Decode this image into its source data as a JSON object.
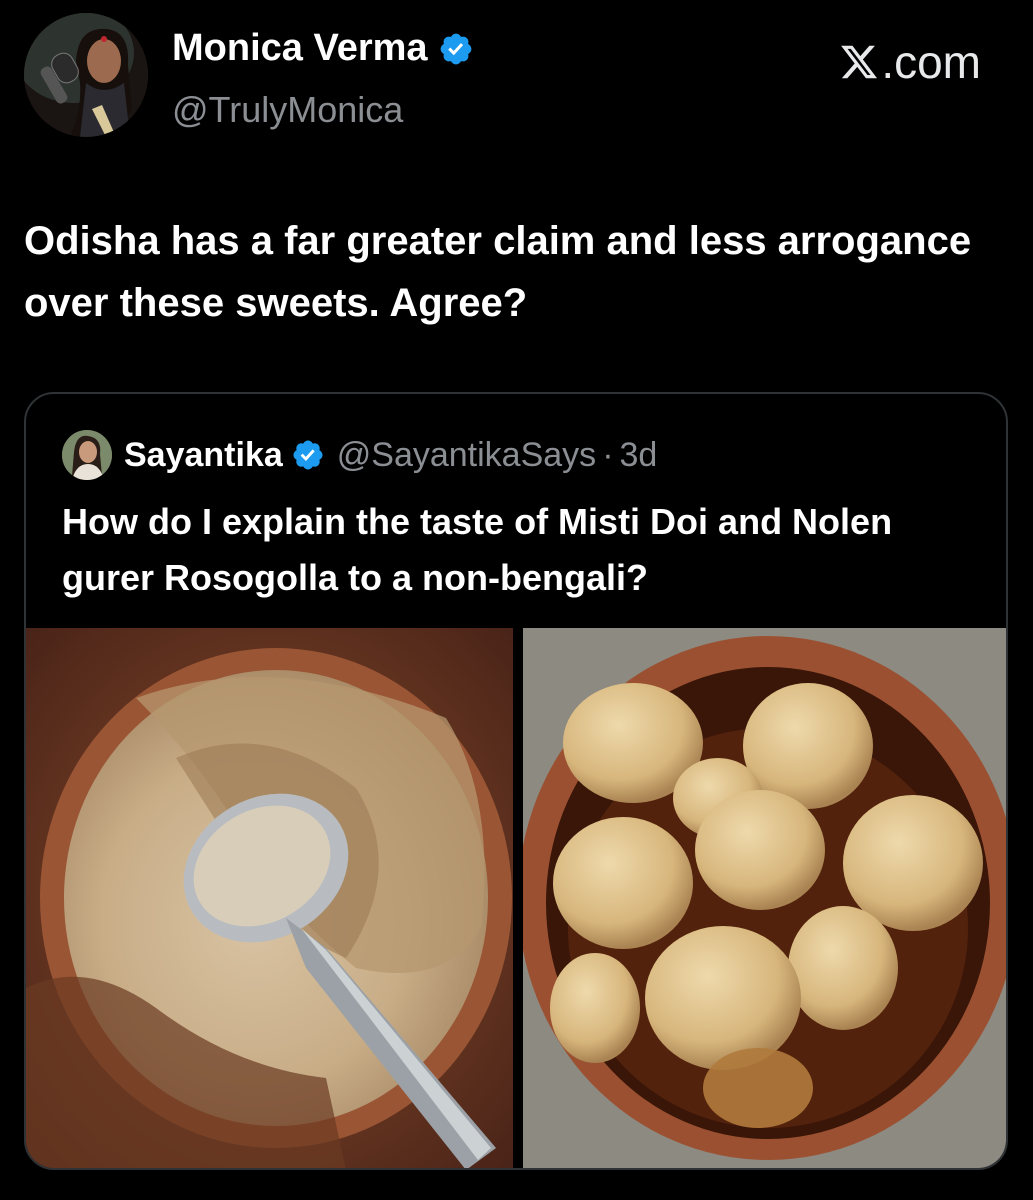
{
  "post": {
    "author": {
      "name": "Monica Verma",
      "handle": "@TrulyMonica",
      "verified": true,
      "avatar_icon": "profile-photo"
    },
    "source": {
      "label": ".com",
      "logo_icon": "x-logo"
    },
    "text": "Odisha has a far greater claim and less arrogance over these sweets. Agree?"
  },
  "quoted_post": {
    "author": {
      "name": "Sayantika",
      "handle": "@SayantikaSays",
      "verified": true,
      "avatar_icon": "profile-photo"
    },
    "separator": "·",
    "time": "3d",
    "text": "How do I explain the taste of Misti Doi and Nolen gurer Rosogolla to a non-bengali?",
    "media": [
      {
        "icon": "misti-doi-photo"
      },
      {
        "icon": "rosogolla-photo"
      }
    ]
  },
  "colors": {
    "background": "#000000",
    "primary_text": "#ffffff",
    "secondary_text": "#8b8f94",
    "verified_badge": "#1d9bf0",
    "card_border": "#2f3336"
  }
}
